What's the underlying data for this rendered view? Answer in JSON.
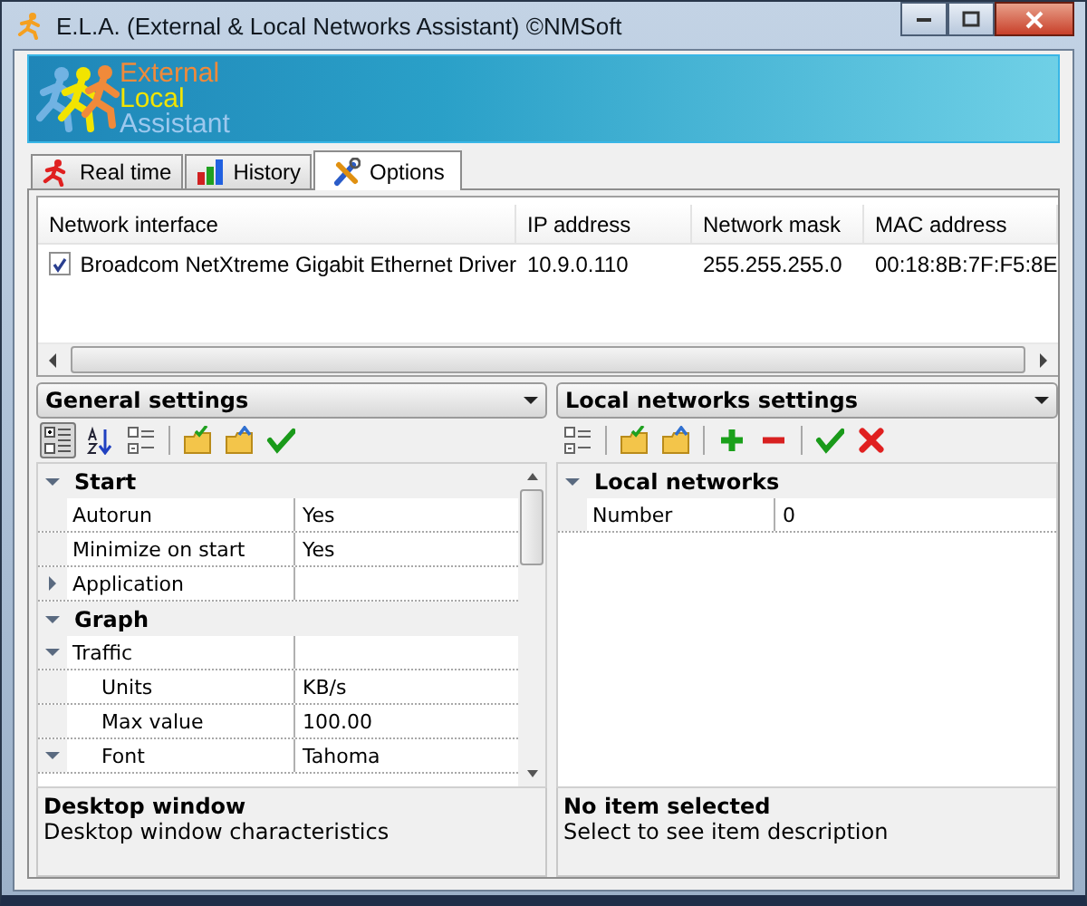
{
  "window": {
    "title": "E.L.A. (External & Local Networks Assistant) ©NMSoft"
  },
  "banner": {
    "lines": [
      {
        "text": "External",
        "color": "#f08a3a"
      },
      {
        "text": "Local",
        "color": "#f2e400"
      },
      {
        "text": "Assistant",
        "color": "#9cc8ee"
      }
    ]
  },
  "tabs": [
    {
      "label": "Real time",
      "kind": "runner",
      "selected": false
    },
    {
      "label": "History",
      "kind": "chart",
      "selected": false
    },
    {
      "label": "Options",
      "kind": "tools",
      "selected": true
    }
  ],
  "network_list": {
    "columns": [
      "Network interface",
      "IP address",
      "Network mask",
      "MAC address"
    ],
    "rows": [
      {
        "checked": true,
        "cells": [
          "Broadcom NetXtreme Gigabit Ethernet Driver",
          "10.9.0.110",
          "255.255.255.0",
          "00:18:8B:7F:F5:8E"
        ]
      }
    ]
  },
  "panes": [
    {
      "title": "General settings",
      "scrollbar": true,
      "toolbar_groups": [
        [
          {
            "kind": "categorized",
            "selected": true
          },
          {
            "kind": "alphabetical",
            "selected": false
          },
          {
            "kind": "pages",
            "selected": false
          }
        ],
        [
          {
            "kind": "folder-load",
            "selected": false
          },
          {
            "kind": "folder-save",
            "selected": false
          },
          {
            "kind": "apply",
            "selected": false
          }
        ]
      ],
      "properties": [
        {
          "kind": "category",
          "label": "Start",
          "expanded": true,
          "children": [
            {
              "kind": "property",
              "label": "Autorun",
              "value": "Yes"
            },
            {
              "kind": "property",
              "label": "Minimize on start",
              "value": "Yes"
            },
            {
              "kind": "property",
              "label": "Application",
              "expanded": false
            }
          ]
        },
        {
          "kind": "category",
          "label": "Graph",
          "expanded": true,
          "children": [
            {
              "kind": "property",
              "label": "Traffic",
              "expanded": true,
              "children": [
                {
                  "kind": "property",
                  "label": "Units",
                  "value": "KB/s"
                },
                {
                  "kind": "property",
                  "label": "Max value",
                  "value": "100.00"
                },
                {
                  "kind": "property",
                  "label": "Font",
                  "value": "Tahoma",
                  "expanded": true
                }
              ]
            }
          ]
        }
      ],
      "description": {
        "title": "Desktop window",
        "text": "Desktop window characteristics"
      }
    },
    {
      "title": "Local networks settings",
      "scrollbar": false,
      "toolbar_groups": [
        [
          {
            "kind": "pages",
            "selected": false
          }
        ],
        [
          {
            "kind": "folder-load",
            "selected": false
          },
          {
            "kind": "folder-save",
            "selected": false
          }
        ],
        [
          {
            "kind": "add",
            "selected": false
          },
          {
            "kind": "remove",
            "selected": false
          }
        ],
        [
          {
            "kind": "apply",
            "selected": false
          },
          {
            "kind": "cancel",
            "selected": false
          }
        ]
      ],
      "properties": [
        {
          "kind": "category",
          "label": "Local networks",
          "expanded": true,
          "children": [
            {
              "kind": "property",
              "label": "Number",
              "value": "0"
            }
          ]
        }
      ],
      "description": {
        "title": "No item selected",
        "text": "Select to see item description"
      }
    }
  ]
}
